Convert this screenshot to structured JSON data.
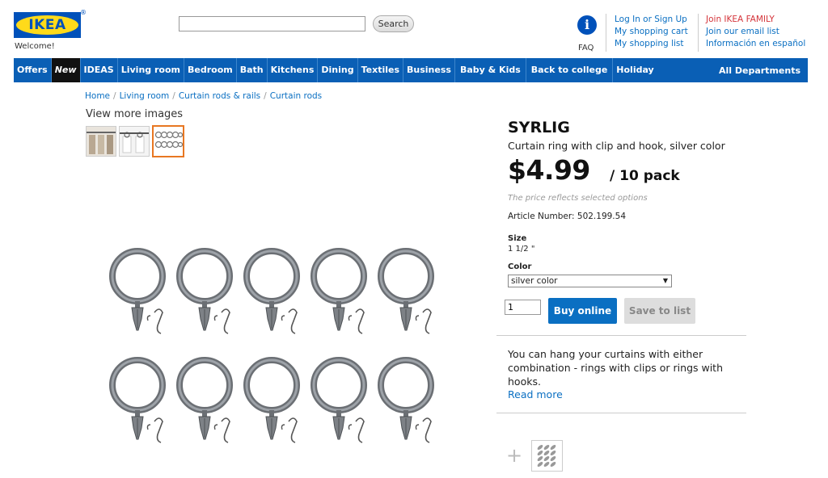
{
  "header": {
    "logo_text": "IKEA",
    "logo_reg": "®",
    "welcome": "Welcome!",
    "search_placeholder": "",
    "search_button": "Search",
    "faq_label": "FAQ",
    "faq_icon_glyph": "i",
    "links_left": [
      "Log In or Sign Up",
      "My shopping cart",
      "My shopping list"
    ],
    "links_right": [
      "Join IKEA FAMILY",
      "Join our email list",
      "Información en español"
    ]
  },
  "nav": {
    "items": [
      "Offers",
      "New",
      "IDEAS",
      "Living room",
      "Bedroom",
      "Bath",
      "Kitchens",
      "Dining",
      "Textiles",
      "Business",
      "Baby & Kids",
      "Back to college",
      "Holiday"
    ],
    "all_departments": "All Departments"
  },
  "breadcrumb": [
    "Home",
    "Living room",
    "Curtain rods & rails",
    "Curtain rods"
  ],
  "gallery": {
    "more_images_label": "View more images"
  },
  "product": {
    "name": "SYRLIG",
    "description": "Curtain ring with clip and hook, silver color",
    "price": "$4.99",
    "pack": "/ 10 pack",
    "price_note": "The price reflects selected options",
    "article": "Article Number: 502.199.54",
    "size_label": "Size",
    "size_value": "1 1/2 \"",
    "color_label": "Color",
    "color_value": "silver color",
    "quantity": "1",
    "buy_button": "Buy online",
    "save_button": "Save to list",
    "blurb": "You can hang your curtains with either combination - rings with clips or rings with hooks.",
    "read_more": "Read more",
    "plus_glyph": "+"
  },
  "colors": {
    "ikea_blue": "#0051ba",
    "ikea_yellow": "#ffda1a",
    "nav_blue": "#0a5fb5",
    "link_blue": "#0a6fc2",
    "family_red": "#d4343a",
    "selected_thumb_border": "#e87722"
  }
}
